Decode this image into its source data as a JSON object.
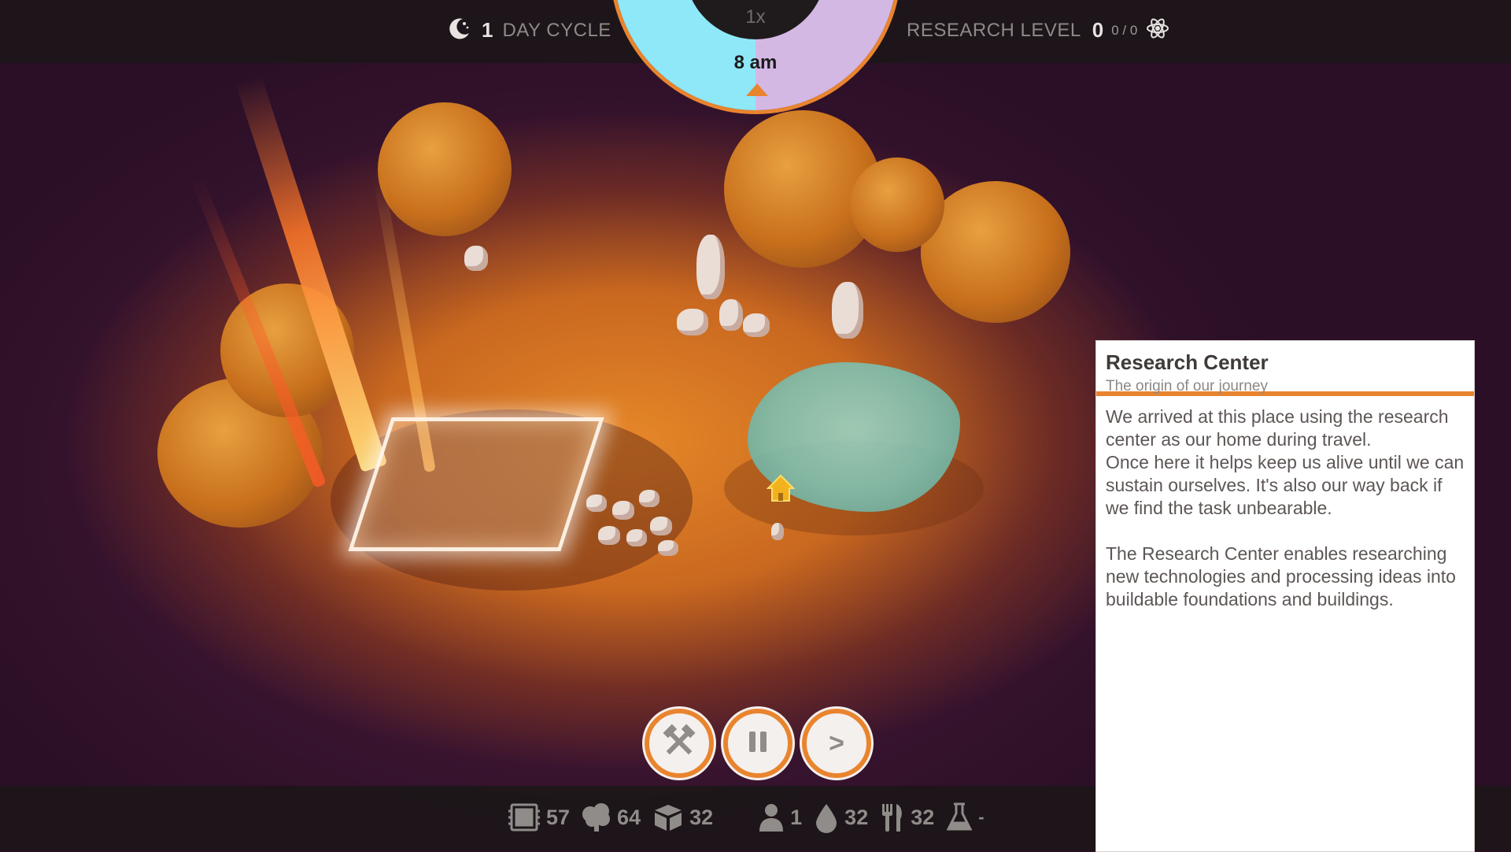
{
  "top_hud": {
    "day_count": "1",
    "day_label": "DAY CYCLE",
    "speed": "1x",
    "time": "8 am",
    "research_label": "RESEARCH LEVEL",
    "research_level": "0",
    "research_progress": "0 / 0"
  },
  "controls": {
    "build_icon": "hammer-pick-icon",
    "pause_icon": "pause-icon",
    "speed_label": ">"
  },
  "resources": [
    {
      "icon": "chip-icon",
      "value": "57"
    },
    {
      "icon": "tree-icon",
      "value": "64"
    },
    {
      "icon": "box-icon",
      "value": "32"
    },
    {
      "icon": "person-icon",
      "value": "1"
    },
    {
      "icon": "water-drop-icon",
      "value": "32"
    },
    {
      "icon": "fork-knife-icon",
      "value": "32"
    },
    {
      "icon": "flask-icon",
      "value": "-"
    }
  ],
  "info_panel": {
    "title": "Research Center",
    "subtitle": "The origin of our journey",
    "paragraph1": "We arrived at this place using the research center as our home during travel.\nOnce here it helps keep us alive until we can sustain ourselves. It's also our way back if we find the task unbearable.",
    "paragraph2": "The Research Center enables researching new technologies and processing ideas into buildable foundations and buildings."
  },
  "colors": {
    "accent": "#e9842e",
    "hud_bg": "#1c1618",
    "clock_day": "#8fe8f8",
    "clock_night": "#d4b8e4"
  }
}
